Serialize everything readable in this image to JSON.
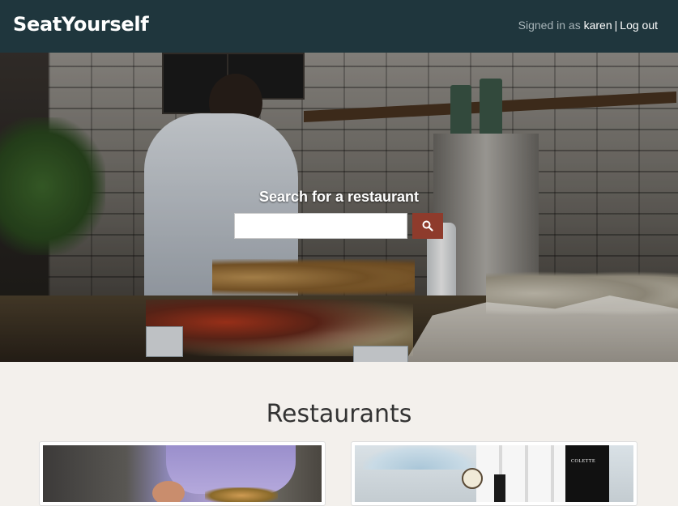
{
  "navbar": {
    "brand": "SeatYourself",
    "signed_in_prefix": "Signed in as",
    "username": "karen",
    "separator": "|",
    "logout_label": "Log out"
  },
  "hero": {
    "search_title": "Search for a restaurant",
    "search_placeholder": "",
    "search_value": "",
    "search_button_icon": "search-icon",
    "accent_color": "#8e3b2c"
  },
  "restaurants": {
    "title": "Restaurants",
    "cards": [
      {
        "image_label": ""
      },
      {
        "image_label": "COLETTE"
      }
    ]
  },
  "colors": {
    "navbar_bg": "#1f363d",
    "page_bg": "#f3f0ec",
    "search_button_bg": "#8e3b2c"
  }
}
